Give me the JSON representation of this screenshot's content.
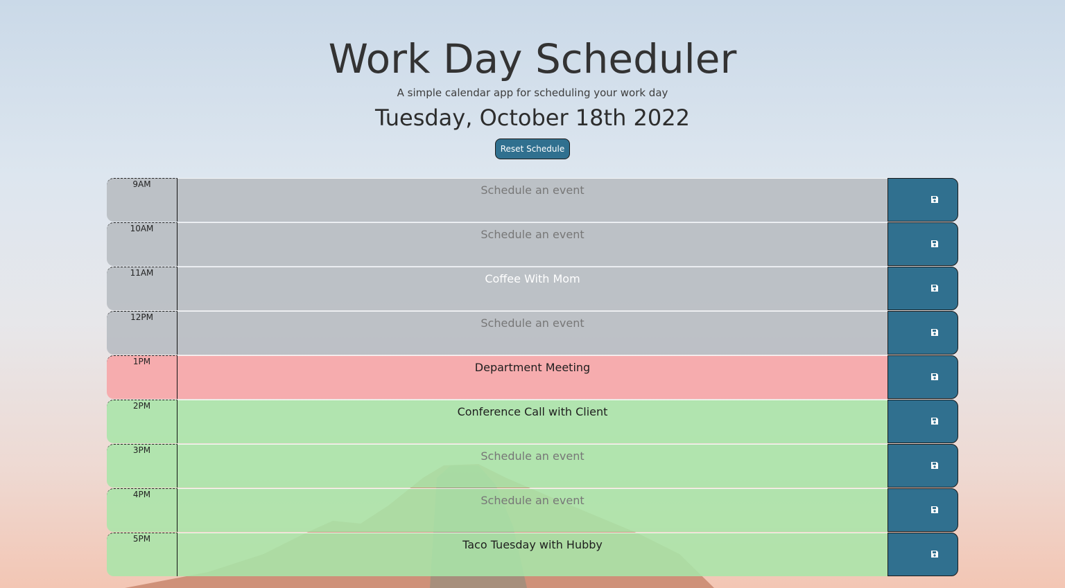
{
  "header": {
    "title": "Work Day Scheduler",
    "subtitle": "A simple calendar app for scheduling your work day",
    "date": "Tuesday, October 18th 2022",
    "reset_label": "Reset Schedule"
  },
  "colors": {
    "past": "#b9bdc3",
    "present": "#f6a8aa",
    "future": "#a8e5a8",
    "button": "#30708f"
  },
  "schedule": {
    "placeholder": "Schedule an event",
    "save_icon": "save-icon",
    "rows": [
      {
        "hour": "9AM",
        "event": "",
        "status": "past"
      },
      {
        "hour": "10AM",
        "event": "",
        "status": "past"
      },
      {
        "hour": "11AM",
        "event": "Coffee With Mom",
        "status": "past"
      },
      {
        "hour": "12PM",
        "event": "",
        "status": "past"
      },
      {
        "hour": "1PM",
        "event": "Department Meeting",
        "status": "present"
      },
      {
        "hour": "2PM",
        "event": "Conference Call with Client",
        "status": "future"
      },
      {
        "hour": "3PM",
        "event": "",
        "status": "future"
      },
      {
        "hour": "4PM",
        "event": "",
        "status": "future"
      },
      {
        "hour": "5PM",
        "event": "Taco Tuesday with Hubby",
        "status": "future"
      }
    ]
  }
}
